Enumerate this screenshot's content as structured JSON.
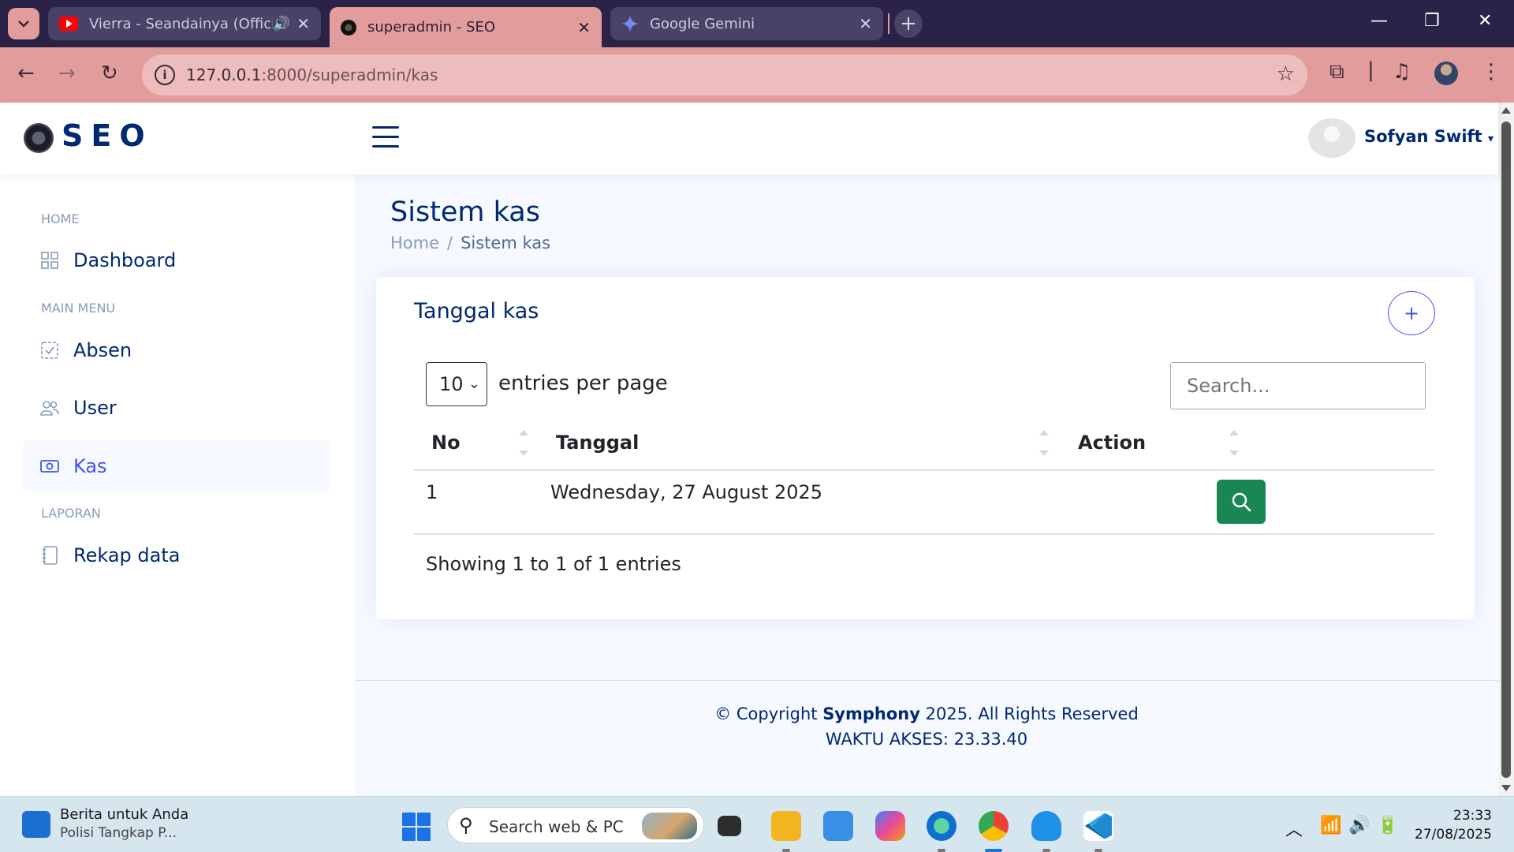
{
  "browser": {
    "tabs": [
      {
        "title": "Vierra - Seandainya (Officia",
        "icon": "youtube-icon"
      },
      {
        "title": "superadmin - SEO",
        "icon": "site-icon"
      },
      {
        "title": "Google Gemini",
        "icon": "gemini-icon"
      }
    ],
    "active_tab": 1,
    "url_host": "127.0.0.1",
    "url_rest": ":8000/superadmin/kas"
  },
  "header": {
    "logo_text": "SEO",
    "user_name": "Sofyan Swift"
  },
  "sidebar": {
    "sections": [
      {
        "heading": "HOME",
        "items": [
          {
            "label": "Dashboard",
            "icon": "grid-icon"
          }
        ]
      },
      {
        "heading": "MAIN MENU",
        "items": [
          {
            "label": "Absen",
            "icon": "check-square-icon"
          },
          {
            "label": "User",
            "icon": "people-icon"
          },
          {
            "label": "Kas",
            "icon": "cash-icon",
            "active": true
          }
        ]
      },
      {
        "heading": "LAPORAN",
        "items": [
          {
            "label": "Rekap data",
            "icon": "journal-icon"
          }
        ]
      }
    ]
  },
  "page": {
    "title": "Sistem kas",
    "breadcrumb": {
      "home": "Home",
      "current": "Sistem kas"
    }
  },
  "card": {
    "title": "Tanggal kas",
    "add_label": "+",
    "per_page_value": "10",
    "per_page_label": "entries per page",
    "search_placeholder": "Search...",
    "columns": [
      "No",
      "Tanggal",
      "Action"
    ],
    "rows": [
      {
        "no": "1",
        "tanggal": "Wednesday, 27 August 2025"
      }
    ],
    "info": "Showing 1 to 1 of 1 entries"
  },
  "footer": {
    "copy_prefix": "© Copyright ",
    "copy_brand": "Symphony",
    "copy_suffix": " 2025. All Rights Reserved",
    "access_time": "WAKTU AKSES: 23.33.40"
  },
  "taskbar": {
    "news_title": "Berita untuk Anda",
    "news_sub": "Polisi Tangkap P...",
    "search_text": "Search web & PC",
    "time": "23:33",
    "date": "27/08/2025"
  },
  "colors": {
    "primary": "#012970",
    "accent": "#4154f1",
    "success": "#198754",
    "chrome": "#e39c9c"
  }
}
